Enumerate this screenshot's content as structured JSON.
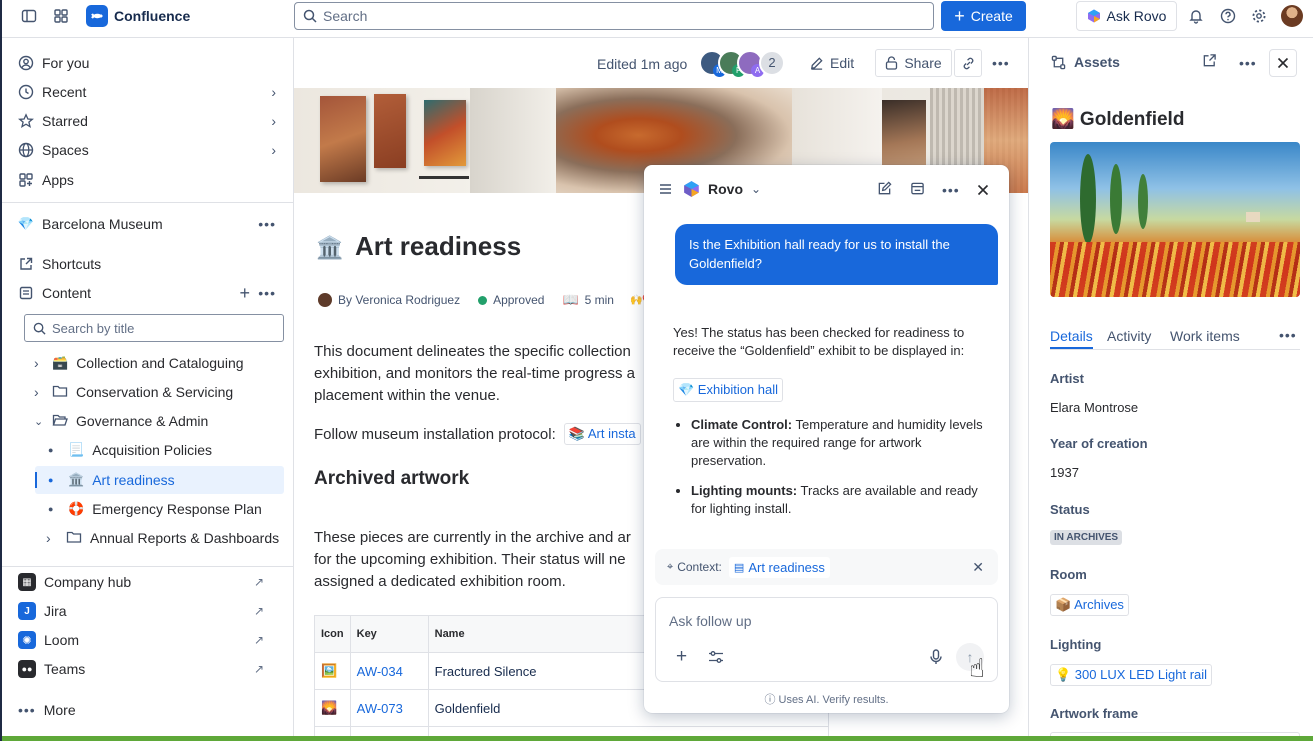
{
  "topbar": {
    "app_name": "Confluence",
    "search_placeholder": "Search",
    "create_label": "Create",
    "ask_rovo_label": "Ask Rovo"
  },
  "sidebar": {
    "top_items": [
      {
        "label": "For you",
        "icon": "user-circle-icon"
      },
      {
        "label": "Recent",
        "icon": "clock-icon"
      },
      {
        "label": "Starred",
        "icon": "star-icon"
      },
      {
        "label": "Spaces",
        "icon": "globe-icon"
      },
      {
        "label": "Apps",
        "icon": "apps-icon"
      }
    ],
    "space_name": "Barcelona Museum",
    "shortcuts_label": "Shortcuts",
    "content_label": "Content",
    "search_placeholder": "Search by title",
    "tree": [
      {
        "label": "Collection and Cataloguing",
        "icon": "archive-box-emoji"
      },
      {
        "label": "Conservation & Servicing",
        "icon": "folder-icon"
      },
      {
        "label": "Governance & Admin",
        "icon": "folder-open-icon"
      },
      {
        "label": "Acquisition Policies",
        "icon": "page-emoji"
      },
      {
        "label": "Art readiness",
        "icon": "museum-emoji"
      },
      {
        "label": "Emergency Response Plan",
        "icon": "lifebuoy-emoji"
      },
      {
        "label": "Annual Reports & Dashboards",
        "icon": "folder-icon"
      }
    ],
    "apps": [
      {
        "label": "Company hub",
        "icon": "company-hub-icon"
      },
      {
        "label": "Jira",
        "icon": "jira-icon"
      },
      {
        "label": "Loom",
        "icon": "loom-icon"
      },
      {
        "label": "Teams",
        "icon": "teams-icon"
      }
    ],
    "more_label": "More"
  },
  "page": {
    "edited": "Edited 1m ago",
    "viewer_count": "2",
    "avatar_letters": [
      "M",
      "F",
      "A"
    ],
    "edit_label": "Edit",
    "share_label": "Share",
    "title_emoji": "🏛️",
    "title": "Art readiness",
    "author": "By Veronica Rodriguez",
    "status": "Approved",
    "read_time": "5 min",
    "reactions": "🙌❤️",
    "intro_line1": "This document delineates the specific collection",
    "intro_line2": "exhibition, and monitors the real-time progress a",
    "intro_line3": "placement within the venue.",
    "protocol_text": "Follow museum installation protocol:",
    "protocol_chip": "📚 Art insta",
    "section_title": "Archived artwork",
    "archive_line1": "These pieces are currently in the archive and ar",
    "archive_line2": "for the upcoming exhibition. Their status will ne",
    "archive_line3": "assigned a dedicated exhibition room.",
    "table_headers": [
      "Icon",
      "Key",
      "Name"
    ],
    "table_rows": [
      {
        "icon": "🖼️",
        "key": "AW-034",
        "name": "Fractured Silence"
      },
      {
        "icon": "🌄",
        "key": "AW-073",
        "name": "Goldenfield"
      }
    ]
  },
  "rovo": {
    "title": "Rovo",
    "user_message": "Is the Exhibition hall ready for us to install the Goldenfield?",
    "reply_intro": "Yes! The status has been checked for readiness to receive the “Goldenfield” exhibit to be displayed in:",
    "location_chip": "💎 Exhibition hall",
    "bullets": [
      {
        "label": "Climate Control:",
        "text": "Temperature and humidity levels are within the required range for artwork preservation."
      },
      {
        "label": "Lighting mounts:",
        "text": "Tracks are available and ready for lighting install."
      }
    ],
    "context_label": "Context:",
    "context_chip": "Art readiness",
    "input_placeholder": "Ask follow up",
    "disclaimer": "Uses AI. Verify results."
  },
  "assets": {
    "title": "Assets",
    "asset_name": "🌄 Goldenfield",
    "tabs": [
      "Details",
      "Activity",
      "Work items"
    ],
    "fields": [
      {
        "label": "Artist",
        "value": "Elara Montrose"
      },
      {
        "label": "Year of creation",
        "value": "1937"
      },
      {
        "label": "Status",
        "value": "IN ARCHIVES"
      },
      {
        "label": "Room",
        "value": "📦 Archives"
      },
      {
        "label": "Lighting",
        "value": "💡 300 LUX LED Light rail"
      },
      {
        "label": "Artwork frame",
        "value": ""
      }
    ]
  },
  "colors": {
    "brand": "#1868db",
    "approved": "#22a06b",
    "rovo_bubble": "#1868db"
  }
}
